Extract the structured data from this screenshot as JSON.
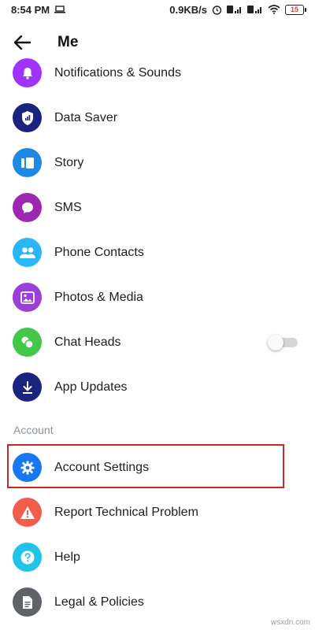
{
  "status_bar": {
    "time": "8:54 PM",
    "speed": "0.9KB/s",
    "battery": "15"
  },
  "header": {
    "title": "Me"
  },
  "items": [
    {
      "label": "Notifications & Sounds",
      "icon": "bell-icon",
      "color": "#a033ff"
    },
    {
      "label": "Data Saver",
      "icon": "shield-signal-icon",
      "color": "#1a237e"
    },
    {
      "label": "Story",
      "icon": "story-icon",
      "color": "#1e88e5"
    },
    {
      "label": "SMS",
      "icon": "chat-bubble-icon",
      "color": "#9c27b0"
    },
    {
      "label": "Phone Contacts",
      "icon": "people-icon",
      "color": "#29b6f6"
    },
    {
      "label": "Photos & Media",
      "icon": "image-icon",
      "color": "#9c3fd6"
    },
    {
      "label": "Chat Heads",
      "icon": "chat-heads-icon",
      "color": "#43c748",
      "toggle": false
    },
    {
      "label": "App Updates",
      "icon": "download-icon",
      "color": "#1a237e"
    }
  ],
  "account_section": {
    "header": "Account",
    "items": [
      {
        "label": "Account Settings",
        "icon": "gear-icon",
        "color": "#1877f2",
        "highlighted": true
      },
      {
        "label": "Report Technical Problem",
        "icon": "warning-icon",
        "color": "#f25c4a"
      },
      {
        "label": "Help",
        "icon": "help-icon",
        "color": "#1fc4e6"
      },
      {
        "label": "Legal & Policies",
        "icon": "document-icon",
        "color": "#5f6368"
      }
    ]
  },
  "watermark": "wsxdn.com",
  "colors": {
    "highlight_border": "#c62828",
    "section_text": "#8d949e"
  }
}
